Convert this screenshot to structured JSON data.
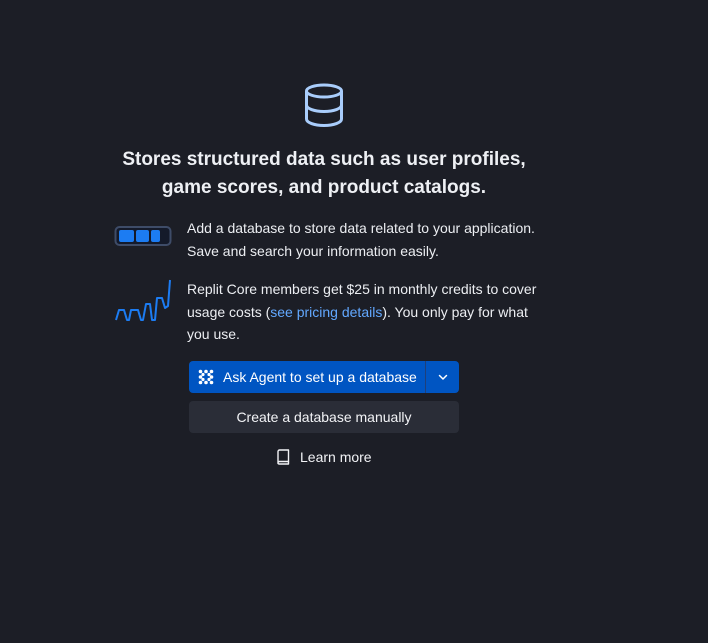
{
  "hero": {
    "icon": "database-icon",
    "headline": "Stores structured data such as user profiles, game scores, and product catalogs."
  },
  "features": [
    {
      "icon": "battery-icon",
      "text": "Add a database to store data related to your application. Save and search your information easily."
    },
    {
      "icon": "usage-chart-icon",
      "text_before": "Replit Core members get $25 in monthly credits to cover usage costs (",
      "link": "see pricing details",
      "text_after": "). You only pay for what you use."
    }
  ],
  "actions": {
    "agent_label": "Ask Agent to set up a database",
    "manual_label": "Create a database manually",
    "learn_more_label": "Learn more"
  },
  "colors": {
    "background": "#1c1e26",
    "primary_button": "#0055c2",
    "secondary_button": "#2a2d37",
    "link": "#62a8ff",
    "icon_accent": "#1c7cf2"
  }
}
